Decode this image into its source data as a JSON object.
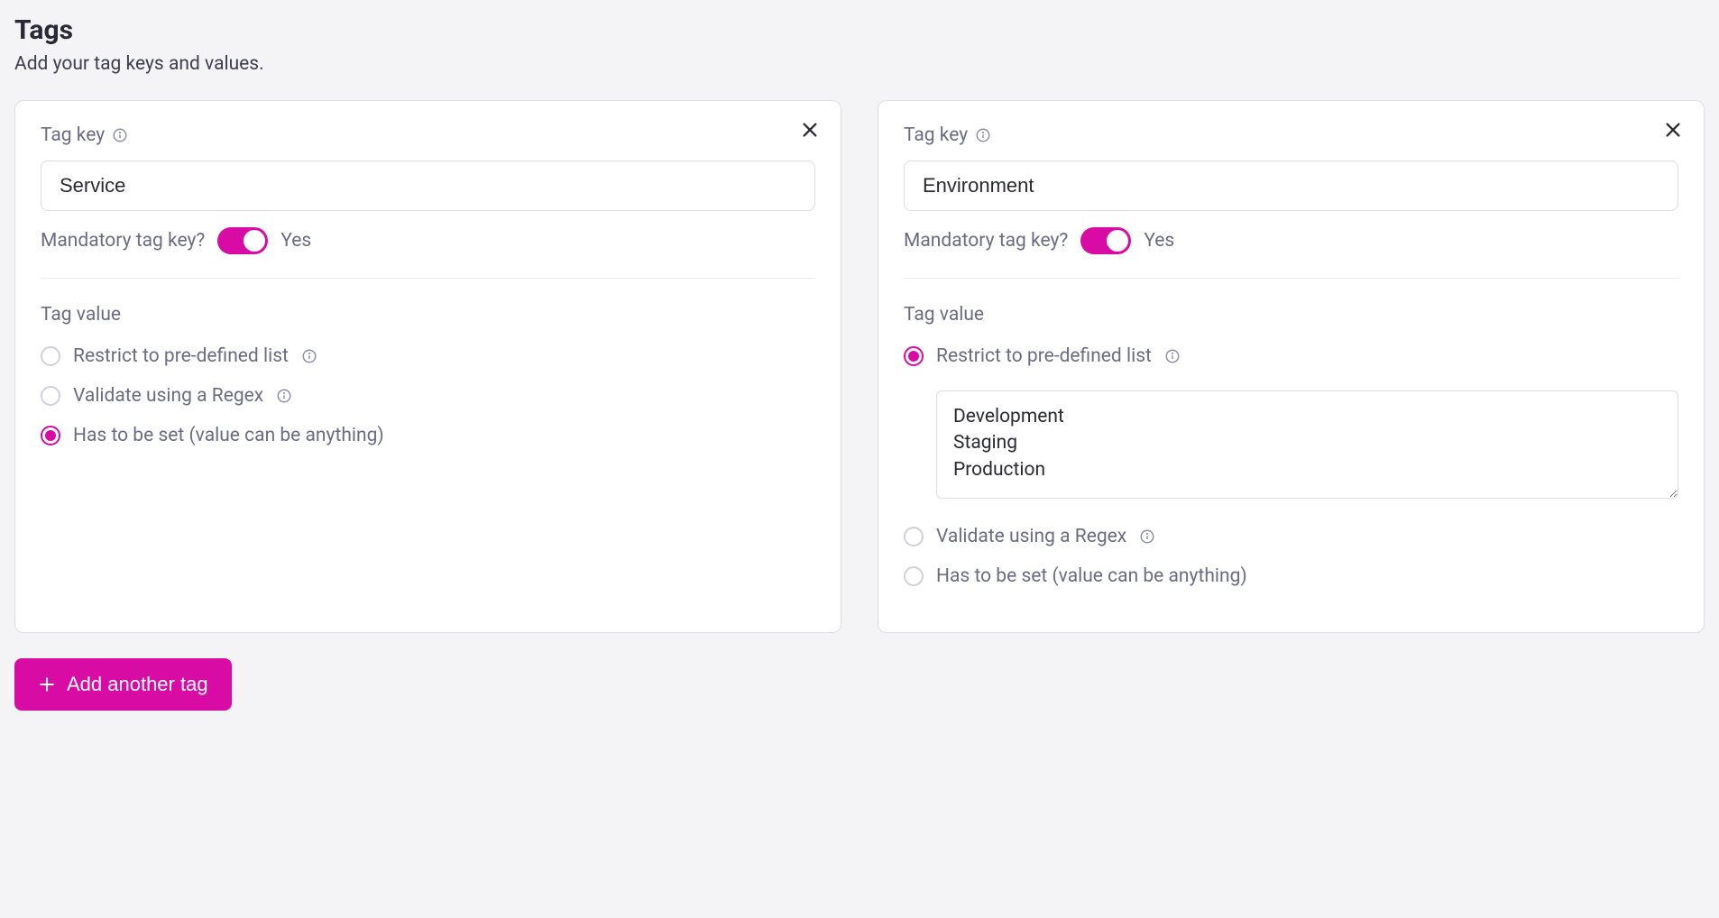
{
  "header": {
    "title": "Tags",
    "subtitle": "Add your tag keys and values."
  },
  "labels": {
    "tag_key": "Tag key",
    "mandatory_question": "Mandatory tag key?",
    "tag_value": "Tag value",
    "option_predefined": "Restrict to pre-defined list",
    "option_regex": "Validate using a Regex",
    "option_any": "Has to be set (value can be anything)",
    "add_button": "Add another tag"
  },
  "cards": [
    {
      "key_value": "Service",
      "mandatory": true,
      "mandatory_text": "Yes",
      "selected_option": "any",
      "predefined_values": ""
    },
    {
      "key_value": "Environment",
      "mandatory": true,
      "mandatory_text": "Yes",
      "selected_option": "predefined",
      "predefined_values": "Development\nStaging\nProduction"
    }
  ]
}
